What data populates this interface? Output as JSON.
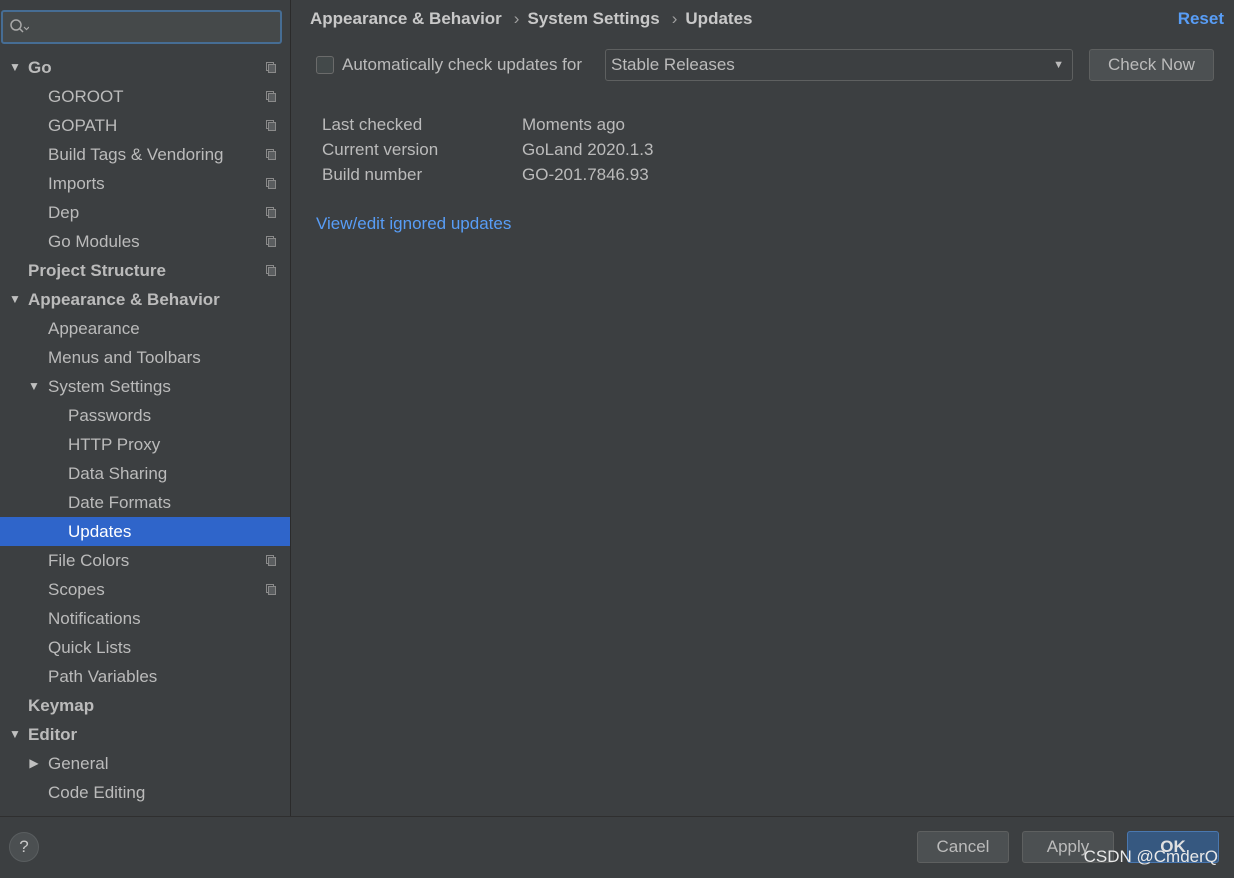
{
  "search": {
    "value": "",
    "placeholder": ""
  },
  "sidebar": {
    "items": [
      {
        "label": "Go",
        "level": 0,
        "bold": true,
        "arrow": "expanded",
        "copy": true
      },
      {
        "label": "GOROOT",
        "level": 1,
        "copy": true
      },
      {
        "label": "GOPATH",
        "level": 1,
        "copy": true
      },
      {
        "label": "Build Tags & Vendoring",
        "level": 1,
        "copy": true
      },
      {
        "label": "Imports",
        "level": 1,
        "copy": true
      },
      {
        "label": "Dep",
        "level": 1,
        "copy": true
      },
      {
        "label": "Go Modules",
        "level": 1,
        "copy": true
      },
      {
        "label": "Project Structure",
        "level": 0,
        "bold": true,
        "copy": true
      },
      {
        "label": "Appearance & Behavior",
        "level": 0,
        "bold": true,
        "arrow": "expanded"
      },
      {
        "label": "Appearance",
        "level": 1
      },
      {
        "label": "Menus and Toolbars",
        "level": 1
      },
      {
        "label": "System Settings",
        "level": 1,
        "arrow": "expanded"
      },
      {
        "label": "Passwords",
        "level": 2
      },
      {
        "label": "HTTP Proxy",
        "level": 2
      },
      {
        "label": "Data Sharing",
        "level": 2
      },
      {
        "label": "Date Formats",
        "level": 2
      },
      {
        "label": "Updates",
        "level": 2,
        "selected": true
      },
      {
        "label": "File Colors",
        "level": 1,
        "copy": true
      },
      {
        "label": "Scopes",
        "level": 1,
        "copy": true
      },
      {
        "label": "Notifications",
        "level": 1
      },
      {
        "label": "Quick Lists",
        "level": 1
      },
      {
        "label": "Path Variables",
        "level": 1
      },
      {
        "label": "Keymap",
        "level": 0,
        "bold": true
      },
      {
        "label": "Editor",
        "level": 0,
        "bold": true,
        "arrow": "expanded"
      },
      {
        "label": "General",
        "level": 1,
        "arrow": "collapsed"
      },
      {
        "label": "Code Editing",
        "level": 1
      }
    ]
  },
  "breadcrumb": {
    "items": [
      "Appearance & Behavior",
      "System Settings",
      "Updates"
    ],
    "separator": "›"
  },
  "header": {
    "reset_label": "Reset"
  },
  "updates": {
    "auto_check_label": "Automatically check updates for",
    "auto_check_checked": false,
    "channel_selected": "Stable Releases",
    "check_now_label": "Check Now",
    "info": [
      {
        "key": "Last checked",
        "value": "Moments ago"
      },
      {
        "key": "Current version",
        "value": "GoLand 2020.1.3"
      },
      {
        "key": "Build number",
        "value": "GO-201.7846.93"
      }
    ],
    "ignored_link": "View/edit ignored updates"
  },
  "footer": {
    "help_label": "?",
    "cancel_label": "Cancel",
    "apply_label": "Apply",
    "ok_label": "OK",
    "watermark": "CSDN @CmderQ"
  },
  "colors": {
    "background": "#3c3f41",
    "selection": "#2f65ca",
    "link": "#589df6",
    "text": "#bbbbbb",
    "search_focus": "#466d94"
  }
}
